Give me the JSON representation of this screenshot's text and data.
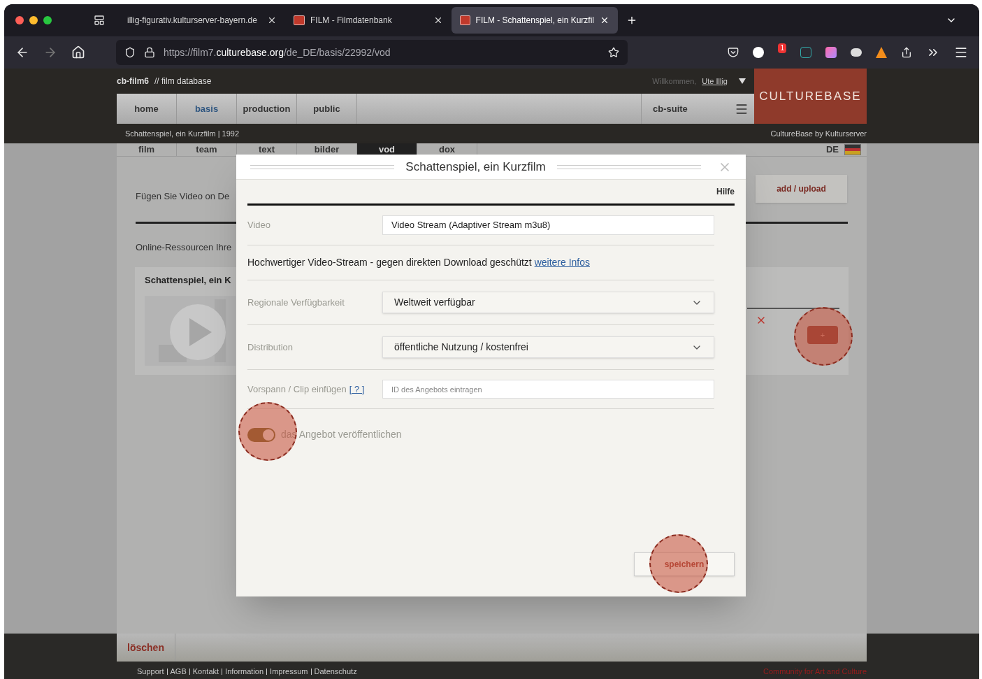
{
  "browser": {
    "tabs": [
      {
        "title": "illig-figurativ.kulturserver-bayern.de",
        "selected": false,
        "kind": "plain"
      },
      {
        "title": "FILM - Filmdatenbank",
        "selected": false,
        "kind": "cb"
      },
      {
        "title": "FILM - Schattenspiel, ein Kurzfil",
        "selected": true,
        "kind": "cb"
      }
    ],
    "url": "https://film7.**culturebase.org**/de_DE/basis/22992/vod",
    "extension_badge": "1"
  },
  "site": {
    "brand": "cb-film6",
    "tagline": "// film database",
    "welcome": "Willkommen,",
    "user": "Ute Illig",
    "nav": [
      {
        "label": "home",
        "selected": false
      },
      {
        "label": "basis",
        "selected": true
      },
      {
        "label": "production",
        "selected": false
      },
      {
        "label": "public",
        "selected": false
      }
    ],
    "suite": "cb-suite",
    "logo": "CULTUREBASE",
    "breadcrumb": "Schattenspiel, ein Kurzfilm | 1992",
    "byline": "CultureBase by Kulturserver",
    "subtabs": [
      {
        "label": "film",
        "selected": false
      },
      {
        "label": "team",
        "selected": false
      },
      {
        "label": "text",
        "selected": false
      },
      {
        "label": "bilder",
        "selected": false
      },
      {
        "label": "vod",
        "selected": true
      },
      {
        "label": "dox",
        "selected": false
      }
    ],
    "language": "DE"
  },
  "background": {
    "intro": "Fügen Sie Video on De",
    "add_button": "add / upload",
    "resources": "Online-Ressourcen Ihre",
    "card_title": "Schattenspiel, ein K",
    "plus_button": "+"
  },
  "modal": {
    "title": "Schattenspiel, ein Kurzfilm",
    "help": "Hilfe",
    "video": {
      "label": "Video",
      "value": "Video Stream (Adaptiver Stream m3u8)"
    },
    "description": "Hochwertiger Video-Stream - gegen direkten Download geschützt",
    "more_link": "weitere Infos",
    "selects": [
      {
        "label": "Regionale Verfügbarkeit",
        "value": "Weltweit verfügbar"
      },
      {
        "label": "Distribution",
        "value": "öffentliche Nutzung / kostenfrei"
      }
    ],
    "clip": {
      "label": "Vorspann / Clip einfügen",
      "help_link": "[ ? ]",
      "placeholder": "ID des Angebots eintragen"
    },
    "publish": {
      "label": "das Angebot veröffentlichen",
      "on": true
    },
    "save": "speichern"
  },
  "footer": {
    "delete": "löschen",
    "links": [
      "Support",
      "AGB",
      "Kontakt",
      "Information",
      "Impressum",
      "Datenschutz"
    ],
    "slogan": "Community for Art and Culture"
  }
}
